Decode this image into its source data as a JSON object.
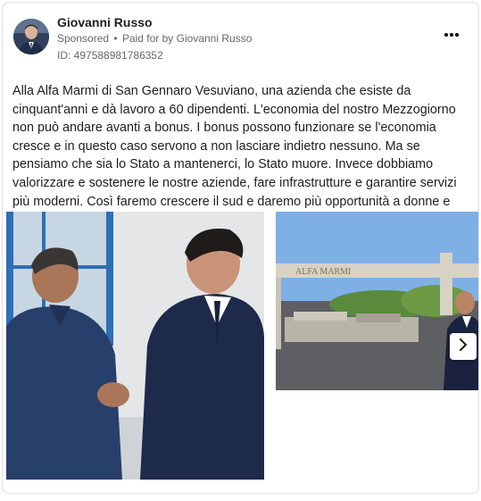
{
  "post": {
    "author": "Giovanni Russo",
    "sponsored_label": "Sponsored",
    "separator": "•",
    "paid_for_prefix": "Paid for by",
    "paid_for_name": "Giovanni Russo",
    "id_line": "ID: 497588981786352",
    "text": "Alla Alfa Marmi di San Gennaro Vesuviano, una azienda che esiste da cinquant'anni e dà lavoro a 60 dipendenti. L'economia del nostro Mezzogiorno non può andare avanti a bonus. I bonus possono funzionare se l'economia cresce e in questo caso servono a non lasciare indietro nessuno. Ma se pensiamo che sia lo Stato a mantenerci, lo Stato muore. Invece dobbiamo valorizzare e sostenere le nostre aziende, fare infrastrutture e garantire servizi più moderni. Così faremo crescere il sud e daremo più opportunità a donne e giovani, contrastando la..."
  },
  "images": {
    "sign_text": "ALFA MARMI"
  },
  "icons": {
    "more": "more-horizontal-icon",
    "next": "chevron-right-icon"
  },
  "colors": {
    "secondary_text": "#65676b",
    "primary_text": "#1c1e21",
    "border": "#dddfe2"
  }
}
